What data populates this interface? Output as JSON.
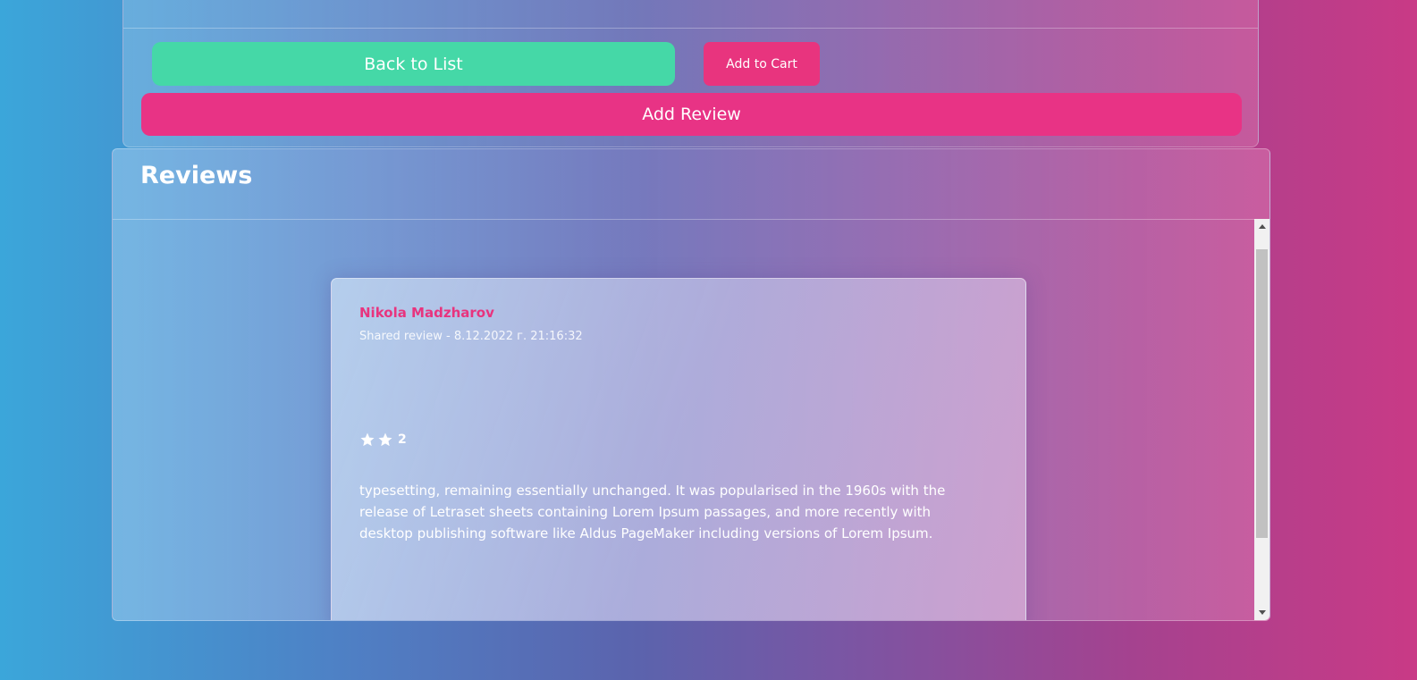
{
  "actions": {
    "back_label": "Back to List",
    "cart_label": "Add to Cart",
    "review_label": "Add Review"
  },
  "reviews": {
    "title": "Reviews",
    "items": [
      {
        "author": "Nikola Madzharov",
        "meta": "Shared review - 8.12.2022 г. 21:16:32",
        "stars": 2,
        "rating_label": "2",
        "text": "typesetting, remaining essentially unchanged. It was popularised in the 1960s with the release of Letraset sheets containing Lorem Ipsum passages, and more recently with desktop publishing software like Aldus PageMaker including versions of Lorem Ipsum."
      }
    ]
  },
  "colors": {
    "back_button": "#45d8a7",
    "accent_pink": "#e8347e",
    "text_white": "#ffffff"
  },
  "icons": {
    "star": "star-icon",
    "scroll_up": "scroll-up-arrow-icon",
    "scroll_down": "scroll-down-arrow-icon"
  }
}
